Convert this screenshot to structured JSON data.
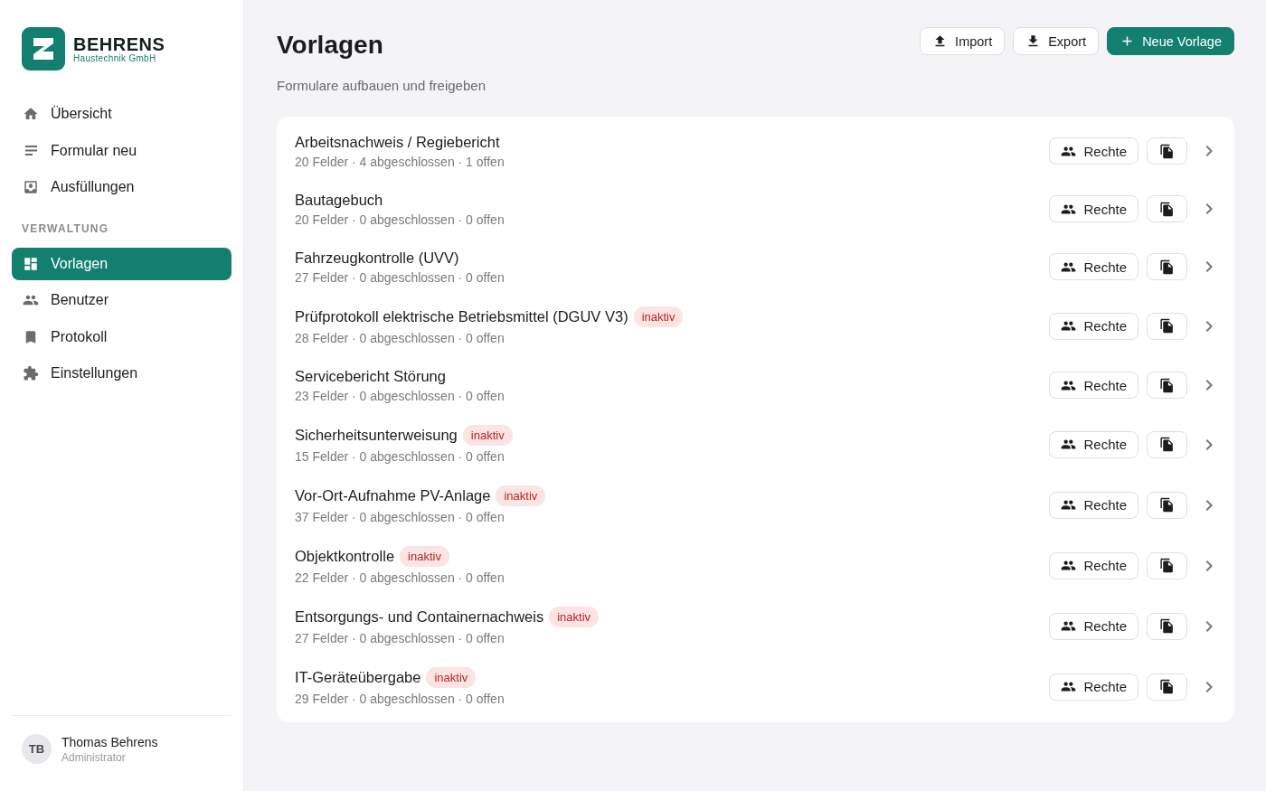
{
  "brand": {
    "name": "BEHRENS",
    "subtitle": "Haustechnik GmbH"
  },
  "nav": [
    {
      "label": "Übersicht",
      "selected": false
    },
    {
      "label": "Formular neu",
      "selected": false
    },
    {
      "label": "Ausfüllungen",
      "selected": false
    }
  ],
  "section_label": "VERWALTUNG",
  "admin_nav": [
    {
      "label": "Vorlagen",
      "selected": true
    },
    {
      "label": "Benutzer",
      "selected": false
    },
    {
      "label": "Protokoll",
      "selected": false
    },
    {
      "label": "Einstellungen",
      "selected": false
    }
  ],
  "user": {
    "initials": "TB",
    "name": "Thomas Behrens",
    "role": "Administrator"
  },
  "header": {
    "title": "Vorlagen",
    "subtitle": "Formulare aufbauen und freigeben"
  },
  "actions": [
    {
      "label": "Import",
      "kind": "upload"
    },
    {
      "label": "Export",
      "kind": "download"
    },
    {
      "label": "Neue Vorlage",
      "kind": "primary"
    }
  ],
  "templates": [
    {
      "title": "Arbeitsnachweis / Regiebericht",
      "meta": "20 Felder · 4 abgeschlossen · 1 offen",
      "rights": "Rechte"
    },
    {
      "title": "Bautagebuch",
      "meta": "20 Felder · 0 abgeschlossen · 0 offen",
      "rights": "Rechte"
    },
    {
      "title": "Fahrzeugkontrolle (UVV)",
      "meta": "27 Felder · 0 abgeschlossen · 0 offen",
      "rights": "Rechte"
    },
    {
      "title": "Prüfprotokoll elektrische Betriebsmittel (DGUV V3)",
      "meta": "28 Felder · 0 abgeschlossen · 0 offen",
      "badge": "inaktiv",
      "rights": "Rechte"
    },
    {
      "title": "Servicebericht Störung",
      "meta": "23 Felder · 0 abgeschlossen · 0 offen",
      "rights": "Rechte"
    },
    {
      "title": "Sicherheitsunterweisung",
      "meta": "15 Felder · 0 abgeschlossen · 0 offen",
      "badge": "inaktiv",
      "rights": "Rechte"
    },
    {
      "title": "Vor-Ort-Aufnahme PV-Anlage",
      "meta": "37 Felder · 0 abgeschlossen · 0 offen",
      "badge": "inaktiv",
      "rights": "Rechte"
    },
    {
      "title": "Objektkontrolle",
      "meta": "22 Felder · 0 abgeschlossen · 0 offen",
      "badge": "inaktiv",
      "rights": "Rechte"
    },
    {
      "title": "Entsorgungs- und Containernachweis",
      "meta": "27 Felder · 0 abgeschlossen · 0 offen",
      "badge": "inaktiv",
      "rights": "Rechte"
    },
    {
      "title": "IT-Geräteübergabe",
      "meta": "29 Felder · 0 abgeschlossen · 0 offen",
      "badge": "inaktiv",
      "rights": "Rechte"
    }
  ]
}
